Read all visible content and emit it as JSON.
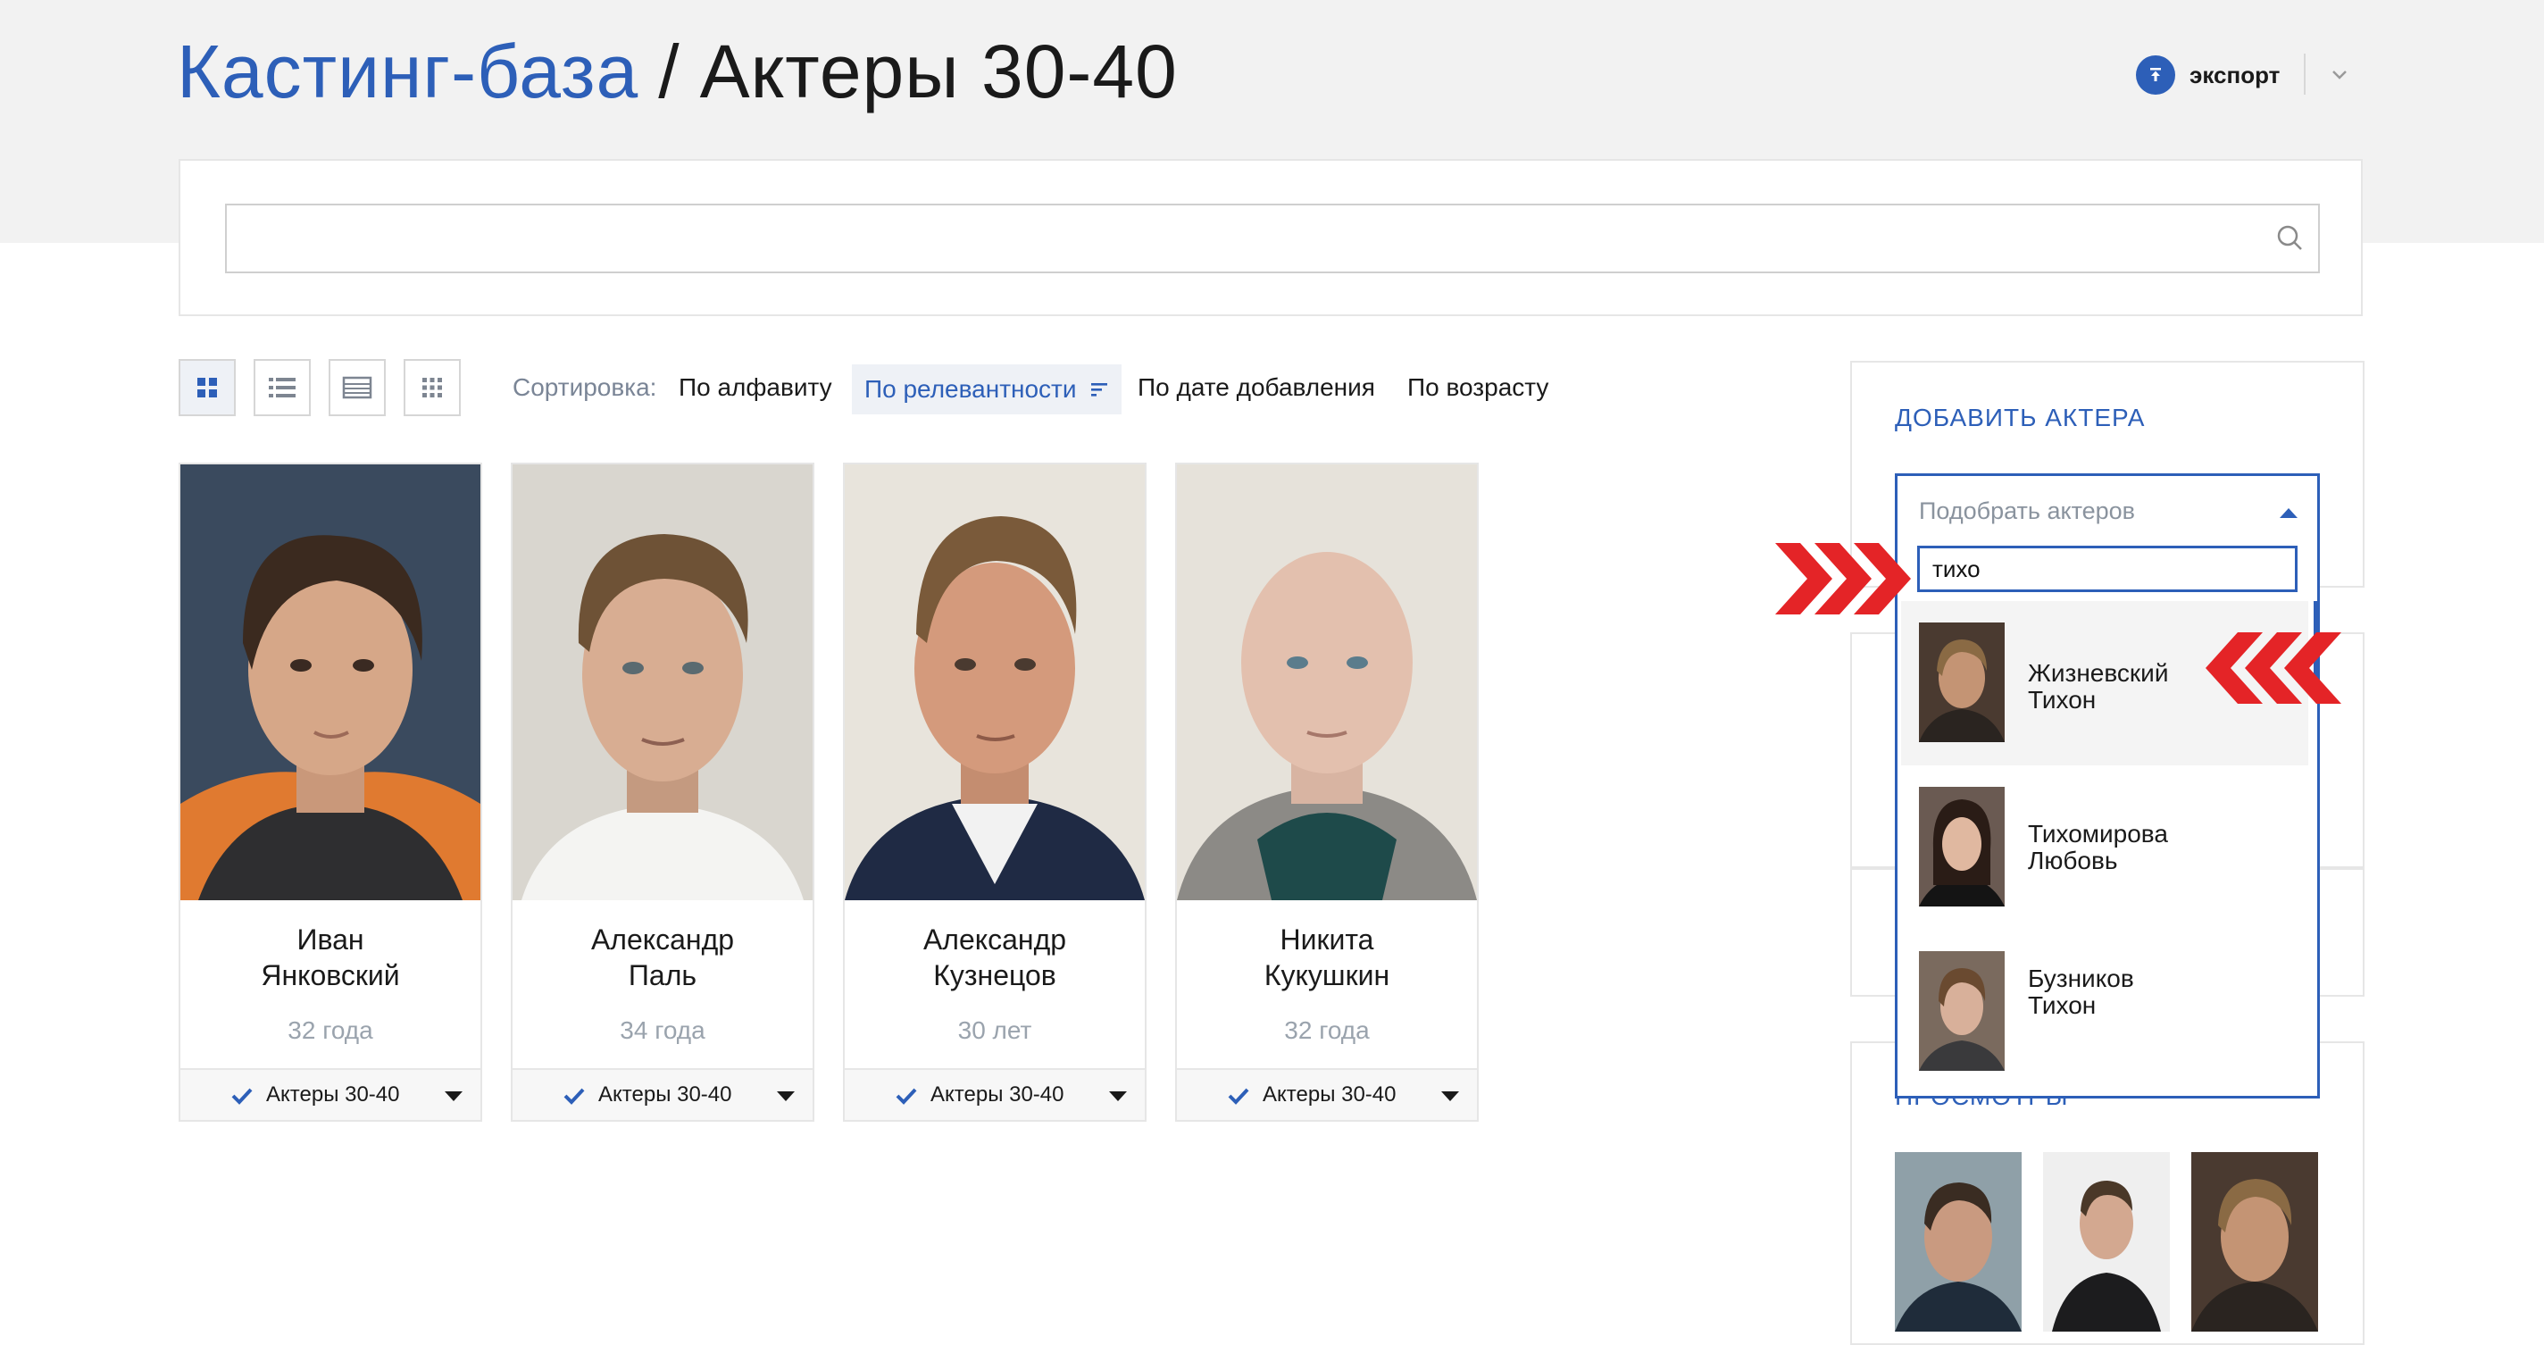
{
  "header": {
    "breadcrumb_root": "Кастинг-база",
    "breadcrumb_separator": "/",
    "breadcrumb_current": "Актеры 30-40",
    "export_label": "экспорт",
    "export_icon": "upload-icon",
    "dropdown_icon": "chevron-down-icon"
  },
  "search": {
    "value": "",
    "icon": "search-icon"
  },
  "view_modes": [
    {
      "name": "grid-large",
      "icon": "grid-large-icon",
      "active": true
    },
    {
      "name": "list",
      "icon": "list-icon",
      "active": false
    },
    {
      "name": "table",
      "icon": "table-icon",
      "active": false
    },
    {
      "name": "grid-small",
      "icon": "grid-small-icon",
      "active": false
    }
  ],
  "sort": {
    "label": "Сортировка:",
    "options": [
      "По алфавиту",
      "По релевантности",
      "По дате добавления",
      "По возрасту"
    ],
    "active": "По релевантности",
    "active_icon": "sort-descending-icon"
  },
  "actors": [
    {
      "first_name": "Иван",
      "last_name": "Янковский",
      "age": "32 года",
      "group": "Актеры 30-40"
    },
    {
      "first_name": "Александр",
      "last_name": "Паль",
      "age": "34 года",
      "group": "Актеры 30-40"
    },
    {
      "first_name": "Александр",
      "last_name": "Кузнецов",
      "age": "30 лет",
      "group": "Актеры 30-40"
    },
    {
      "first_name": "Никита",
      "last_name": "Кукушкин",
      "age": "32 года",
      "group": "Актеры 30-40"
    }
  ],
  "add_actor": {
    "title": "ДОБАВИТЬ АКТЕРА",
    "placeholder": "Подобрать актеров",
    "query": "тихо",
    "results": [
      {
        "line1": "Жизневский",
        "line2": "Тихон",
        "highlighted": true
      },
      {
        "line1": "Тихомирова",
        "line2": "Любовь",
        "highlighted": false
      },
      {
        "line1": "Бузников",
        "line2": "Тихон",
        "highlighted": false
      }
    ]
  },
  "views": {
    "title": "ПРОСМОТРЫ"
  },
  "colors": {
    "accent": "#2d5fb8",
    "header_band": "#f2f2f2",
    "muted_text": "#9aa3ad",
    "callout_red": "#e42427"
  }
}
